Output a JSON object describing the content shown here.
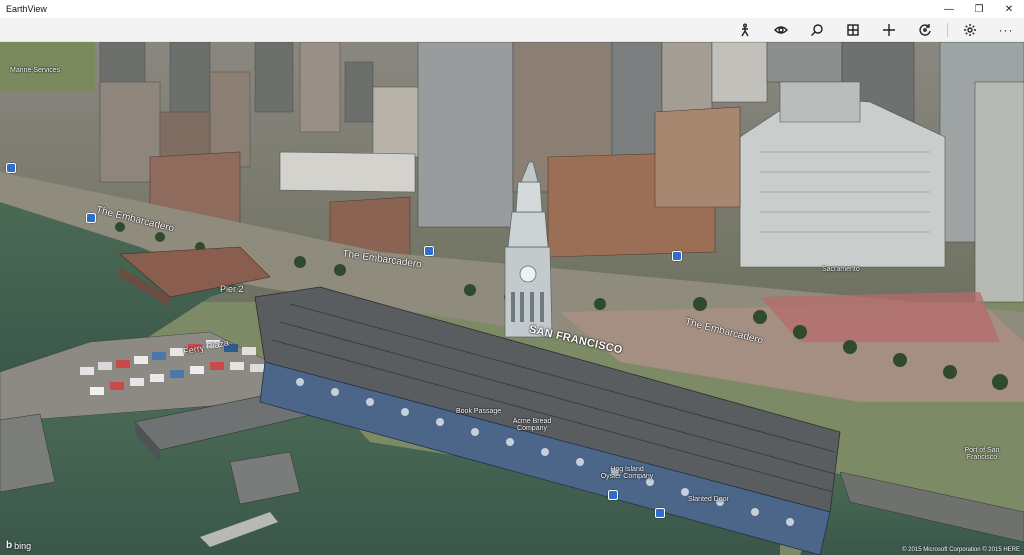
{
  "window": {
    "title": "EarthView",
    "minimize_glyph": "—",
    "maximize_glyph": "❐",
    "close_glyph": "✕"
  },
  "toolbar": {
    "items": [
      {
        "icon": "pedestrian-icon"
      },
      {
        "icon": "eye-icon"
      },
      {
        "icon": "search-icon"
      },
      {
        "icon": "grid-icon"
      },
      {
        "icon": "plus-icon"
      },
      {
        "icon": "rotate-icon"
      },
      {
        "icon": "gear-icon"
      },
      {
        "icon": "more-icon",
        "glyph": "···"
      }
    ]
  },
  "map": {
    "labels": {
      "embarcadero_left": "The Embarcadero",
      "embarcadero_mid": "The Embarcadero",
      "embarcadero_right": "The Embarcadero",
      "pier2": "Pier 2",
      "ferry_plaza": "Ferry Plaza",
      "san_francisco": "SAN FRANCISCO",
      "book_passage": "Book Passage",
      "acme_bread": "Acme Bread Company",
      "hog_island": "Hog Island Oyster Company",
      "slanted_door": "Slanted Door",
      "port_of_sf": "Port of San Francisco",
      "sacramento": "Sacramento",
      "marine_services": "Marine Services"
    }
  },
  "attribution": {
    "logo_b": "b",
    "logo_text": "bing",
    "copyright": "© 2015 Microsoft Corporation © 2015 HERE"
  },
  "colors": {
    "bay": "#3f5c4c",
    "bay_light": "#4c6d58",
    "roof": "#5a5d60",
    "facade_blue": "#4b6688",
    "tower": "#b9c2c6",
    "plaza": "#a98f82"
  }
}
